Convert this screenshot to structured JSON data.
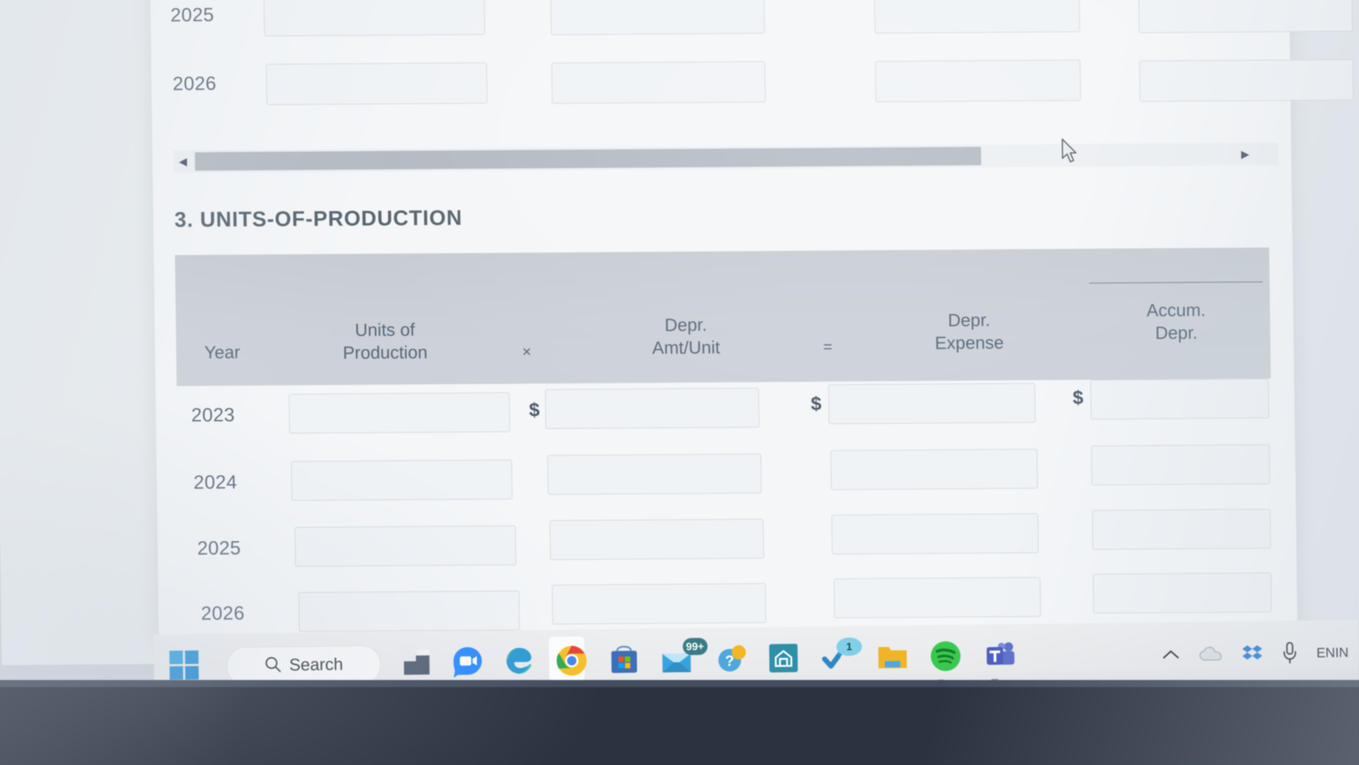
{
  "document": {
    "section_title": "3. UNITS-OF-PRODUCTION"
  },
  "top_table": {
    "rows": [
      {
        "year": "2025",
        "percent_symbol": "%"
      },
      {
        "year": "2026",
        "percent_symbol": "%"
      }
    ]
  },
  "scrollbar": {
    "left_arrow": "◀",
    "right_arrow": "▶"
  },
  "uop_table": {
    "headers": {
      "year": "Year",
      "units_line1": "Units of",
      "units_line2": "Production",
      "times": "×",
      "amt_line1": "Depr.",
      "amt_line2": "Amt/Unit",
      "equals": "=",
      "expense_line1": "Depr.",
      "expense_line2": "Expense",
      "accum_line1": "Accum.",
      "accum_line2": "Depr."
    },
    "rows": [
      {
        "year": "2023",
        "dollar_amt": "$",
        "dollar_expense": "$",
        "dollar_accum": "$"
      },
      {
        "year": "2024",
        "dollar_amt": "",
        "dollar_expense": "",
        "dollar_accum": ""
      },
      {
        "year": "2025",
        "dollar_amt": "",
        "dollar_expense": "",
        "dollar_accum": ""
      },
      {
        "year": "2026",
        "dollar_amt": "",
        "dollar_expense": "",
        "dollar_accum": ""
      }
    ]
  },
  "taskbar": {
    "search_label": "Search",
    "mail_badge": "99+",
    "todo_badge": "1",
    "tray_chevron": "⌃",
    "language_line1": "EN",
    "language_line2": "IN",
    "items": [
      {
        "name": "start",
        "label": "Start"
      },
      {
        "name": "search",
        "label": "Search"
      },
      {
        "name": "file-explorer",
        "label": "File Explorer"
      },
      {
        "name": "zoom",
        "label": "Zoom"
      },
      {
        "name": "edge",
        "label": "Microsoft Edge"
      },
      {
        "name": "chrome",
        "label": "Google Chrome"
      },
      {
        "name": "microsoft-store",
        "label": "Microsoft Store"
      },
      {
        "name": "mail",
        "label": "Mail"
      },
      {
        "name": "help",
        "label": "Get Help"
      },
      {
        "name": "app-teal",
        "label": "App"
      },
      {
        "name": "todo",
        "label": "Microsoft To Do"
      },
      {
        "name": "folder",
        "label": "Folder"
      },
      {
        "name": "spotify",
        "label": "Spotify"
      },
      {
        "name": "teams",
        "label": "Microsoft Teams"
      }
    ],
    "tray": [
      {
        "name": "show-hidden-icons",
        "label": "Show hidden icons"
      },
      {
        "name": "onedrive",
        "label": "OneDrive"
      },
      {
        "name": "dropbox",
        "label": "Dropbox"
      },
      {
        "name": "microphone",
        "label": "Microphone"
      },
      {
        "name": "language",
        "label": "EN IN"
      }
    ]
  },
  "colors": {
    "page_bg": "#f4f6f8",
    "table_header_bg": "#ccd2d8",
    "input_border": "#d2d9e0",
    "text": "#5a6878",
    "scrollbar_thumb": "#b2bac2",
    "taskbar_bg": "#edeef0",
    "bezel": "#2b3240"
  }
}
